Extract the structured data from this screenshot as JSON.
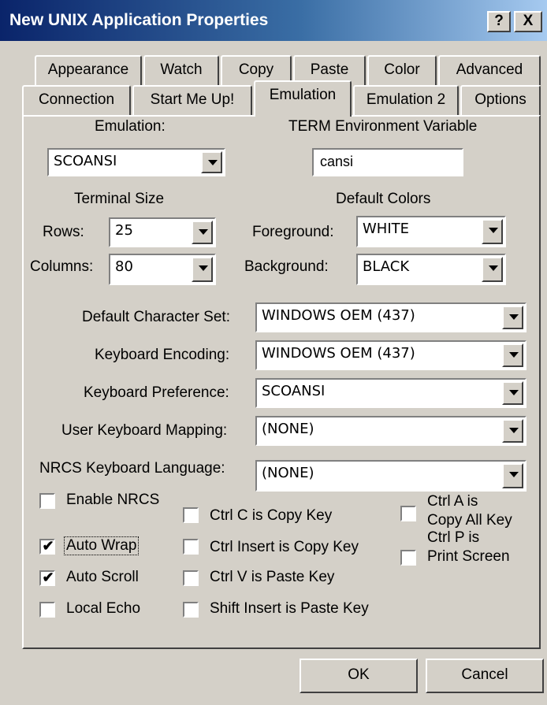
{
  "window": {
    "title": "New UNIX Application Properties",
    "help_label": "?",
    "close_label": "X"
  },
  "tabs_row1": [
    "Appearance",
    "Watch",
    "Copy",
    "Paste",
    "Color",
    "Advanced"
  ],
  "tabs_row2": [
    "Connection",
    "Start Me Up!",
    "Emulation",
    "Emulation 2",
    "Options"
  ],
  "active_tab": "Emulation",
  "emulation": {
    "emulation_label": "Emulation:",
    "emulation_value": "SCOANSI",
    "term_label": "TERM Environment Variable",
    "term_value": "cansi",
    "terminal_size_label": "Terminal Size",
    "rows_label": "Rows:",
    "rows_value": "25",
    "columns_label": "Columns:",
    "columns_value": "80",
    "default_colors_label": "Default Colors",
    "foreground_label": "Foreground:",
    "foreground_value": "WHITE",
    "background_label": "Background:",
    "background_value": "BLACK",
    "charset_label": "Default Character Set:",
    "charset_value": "WINDOWS OEM (437)",
    "kb_encoding_label": "Keyboard Encoding:",
    "kb_encoding_value": "WINDOWS OEM (437)",
    "kb_pref_label": "Keyboard Preference:",
    "kb_pref_value": "SCOANSI",
    "user_kb_label": "User Keyboard Mapping:",
    "user_kb_value": "(NONE)",
    "nrcs_label": "NRCS Keyboard Language:",
    "nrcs_value": "(NONE)"
  },
  "checkboxes": {
    "enable_nrcs": {
      "label": "Enable NRCS",
      "checked": false
    },
    "auto_wrap": {
      "label": "Auto Wrap",
      "checked": true
    },
    "auto_scroll": {
      "label": "Auto Scroll",
      "checked": true
    },
    "local_echo": {
      "label": "Local Echo",
      "checked": false
    },
    "ctrl_c": {
      "label": "Ctrl C is Copy Key",
      "checked": false
    },
    "ctrl_insert": {
      "label": "Ctrl Insert is Copy Key",
      "checked": false
    },
    "ctrl_v": {
      "label": "Ctrl V is Paste Key",
      "checked": false
    },
    "shift_insert": {
      "label": "Shift Insert is Paste Key",
      "checked": false
    },
    "ctrl_a_line1": "Ctrl A is",
    "ctrl_a_line2": "Copy All Key",
    "ctrl_a_checked": false,
    "ctrl_p_line1": "Ctrl P is",
    "ctrl_p_line2": "Print Screen",
    "ctrl_p_checked": false
  },
  "buttons": {
    "ok": "OK",
    "cancel": "Cancel"
  },
  "check_glyph": "✔"
}
